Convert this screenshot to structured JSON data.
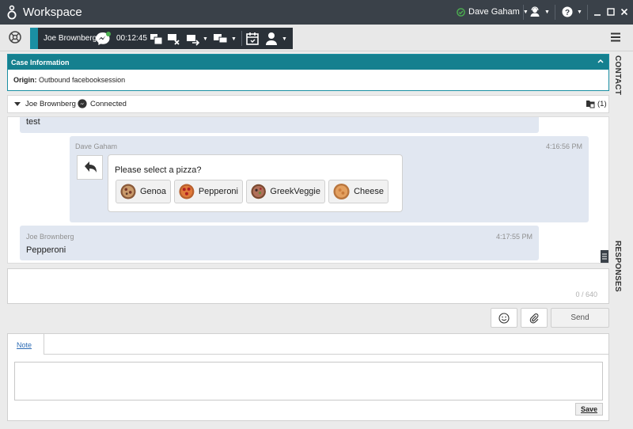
{
  "app": {
    "title": "Workspace"
  },
  "titlebar": {
    "agent_name": "Dave Gaham",
    "agent_status_color": "#4caf50"
  },
  "interaction_bar": {
    "contact_name": "Joe Brownberg",
    "timer": "00:12:45"
  },
  "case_info": {
    "header": "Case Information",
    "origin_label": "Origin:",
    "origin_value": "Outbound facebooksession"
  },
  "side_tabs": {
    "contact": "CONTACT",
    "responses": "RESPONSES"
  },
  "conversation": {
    "contact_name": "Joe Brownberg",
    "status": "Connected",
    "case_count": "(1)"
  },
  "chat": {
    "messages": [
      {
        "text": "test"
      },
      {
        "sender": "Dave Gaham",
        "time": "4:16:56 PM",
        "card_title": "Please select a pizza?",
        "options": [
          "Genoa",
          "Pepperoni",
          "GreekVeggie",
          "Cheese"
        ]
      },
      {
        "sender": "Joe Brownberg",
        "time": "4:17:55 PM",
        "text": "Pepperoni"
      }
    ]
  },
  "compose": {
    "counter": "0 / 640",
    "send_label": "Send"
  },
  "note": {
    "tab_label": "Note",
    "save_label": "Save"
  },
  "colors": {
    "accent": "#15808f",
    "titlebar": "#3a4149",
    "interaction_bar": "#2a3138",
    "bubble": "#e1e7f1"
  }
}
